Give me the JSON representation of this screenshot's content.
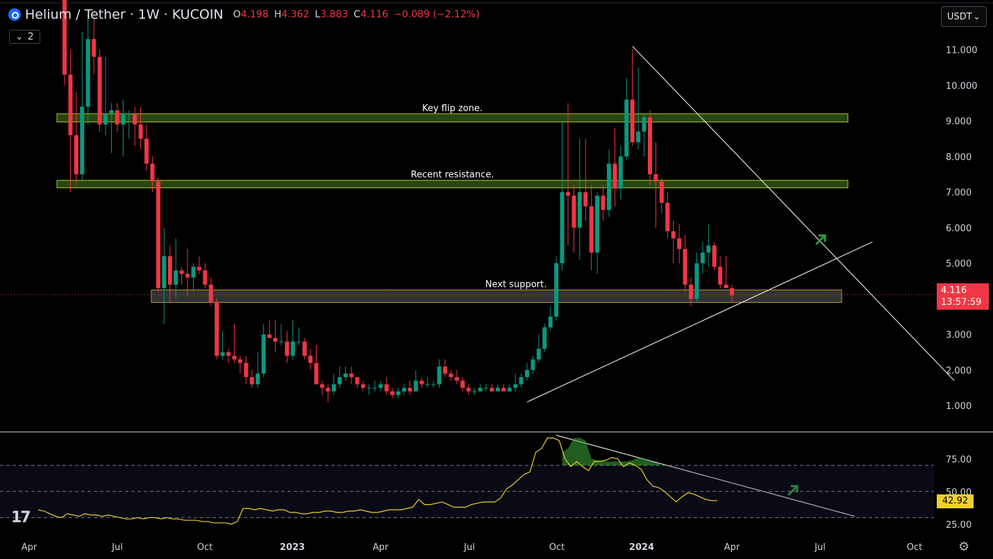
{
  "header": {
    "title": "Helium / Tether · 1W · KUCOIN",
    "open_label": "O",
    "open": "4.198",
    "high_label": "H",
    "high": "4.362",
    "low_label": "L",
    "low": "3.883",
    "close_label": "C",
    "close": "4.116",
    "change": "−0.089 (−2.12%)",
    "indicator_count": "2"
  },
  "currency": "USDT",
  "price_tag": {
    "price": "4.116",
    "countdown": "13:57:59"
  },
  "rsi_tag": "42.92",
  "colors": {
    "up": "#089981",
    "down": "#f23645",
    "rsi": "#f0d02b",
    "zone_green": "#4a7f1c",
    "zone_gray": "#6e6e6e"
  },
  "chart_data": {
    "type": "candlestick",
    "symbol": "Helium / Tether",
    "timeframe": "1W",
    "exchange": "KUCOIN",
    "x_ticks": [
      "Apr",
      "Jul",
      "Oct",
      "2023",
      "Apr",
      "Jul",
      "Oct",
      "2024",
      "Apr",
      "Jul",
      "Oct"
    ],
    "y_ticks": [
      "11.000",
      "10.000",
      "9.000",
      "8.000",
      "7.000",
      "6.000",
      "5.000",
      "4.000",
      "3.000",
      "2.000",
      "1.000"
    ],
    "ylim": [
      0.3,
      12.3
    ],
    "candles": [
      [
        12.5,
        13.5,
        10.0,
        10.3
      ],
      [
        10.3,
        11.0,
        7.0,
        8.6
      ],
      [
        8.6,
        9.8,
        7.2,
        7.5
      ],
      [
        7.5,
        11.5,
        7.3,
        9.4
      ],
      [
        9.4,
        12.0,
        8.9,
        11.3
      ],
      [
        11.3,
        11.9,
        10.3,
        10.8
      ],
      [
        10.8,
        11.0,
        8.7,
        8.9
      ],
      [
        8.9,
        10.8,
        8.6,
        9.2
      ],
      [
        9.2,
        9.5,
        8.1,
        9.3
      ],
      [
        9.3,
        9.5,
        8.7,
        8.9
      ],
      [
        8.9,
        9.6,
        8.0,
        9.2
      ],
      [
        9.2,
        9.3,
        8.5,
        9.2
      ],
      [
        9.2,
        9.4,
        8.3,
        8.9
      ],
      [
        8.9,
        9.4,
        8.2,
        8.5
      ],
      [
        8.5,
        8.9,
        7.6,
        7.8
      ],
      [
        7.8,
        8.0,
        7.0,
        7.3
      ],
      [
        7.3,
        7.4,
        4.2,
        4.3
      ],
      [
        4.3,
        6.0,
        3.3,
        5.2
      ],
      [
        5.2,
        5.5,
        3.9,
        4.4
      ],
      [
        4.4,
        5.7,
        4.0,
        4.8
      ],
      [
        4.8,
        4.9,
        4.4,
        4.7
      ],
      [
        4.7,
        5.4,
        4.1,
        4.6
      ],
      [
        4.6,
        5.0,
        4.2,
        4.9
      ],
      [
        4.9,
        5.2,
        4.7,
        4.8
      ],
      [
        4.8,
        5.0,
        4.3,
        4.4
      ],
      [
        4.4,
        4.6,
        3.8,
        3.9
      ],
      [
        3.9,
        4.0,
        2.3,
        2.4
      ],
      [
        2.4,
        3.1,
        2.3,
        2.5
      ],
      [
        2.5,
        2.6,
        2.2,
        2.4
      ],
      [
        2.4,
        3.3,
        2.2,
        2.3
      ],
      [
        2.3,
        2.4,
        1.9,
        2.2
      ],
      [
        2.2,
        2.4,
        1.6,
        1.8
      ],
      [
        1.8,
        2.0,
        1.5,
        1.6
      ],
      [
        1.6,
        2.5,
        1.5,
        1.9
      ],
      [
        1.9,
        3.3,
        1.8,
        3.0
      ],
      [
        3.0,
        3.4,
        2.9,
        2.9
      ],
      [
        2.9,
        3.4,
        2.5,
        2.8
      ],
      [
        2.8,
        3.3,
        2.7,
        2.8
      ],
      [
        2.8,
        3.1,
        2.2,
        2.4
      ],
      [
        2.4,
        3.4,
        2.3,
        2.8
      ],
      [
        2.8,
        3.2,
        2.7,
        2.8
      ],
      [
        2.8,
        2.9,
        2.3,
        2.4
      ],
      [
        2.4,
        2.6,
        2.0,
        2.2
      ],
      [
        2.2,
        2.7,
        1.6,
        1.6
      ],
      [
        1.6,
        1.7,
        1.3,
        1.5
      ],
      [
        1.5,
        1.6,
        1.1,
        1.4
      ],
      [
        1.4,
        1.9,
        1.3,
        1.6
      ],
      [
        1.6,
        2.1,
        1.5,
        1.8
      ],
      [
        1.8,
        2.1,
        1.7,
        1.9
      ],
      [
        1.9,
        2.1,
        1.6,
        1.8
      ],
      [
        1.8,
        1.8,
        1.5,
        1.6
      ],
      [
        1.6,
        1.7,
        1.4,
        1.5
      ],
      [
        1.5,
        1.6,
        1.3,
        1.5
      ],
      [
        1.5,
        1.7,
        1.4,
        1.5
      ],
      [
        1.5,
        1.7,
        1.4,
        1.6
      ],
      [
        1.6,
        1.8,
        1.3,
        1.4
      ],
      [
        1.4,
        1.5,
        1.2,
        1.3
      ],
      [
        1.3,
        1.5,
        1.2,
        1.4
      ],
      [
        1.4,
        1.6,
        1.3,
        1.5
      ],
      [
        1.5,
        1.7,
        1.3,
        1.4
      ],
      [
        1.4,
        2.0,
        1.4,
        1.7
      ],
      [
        1.7,
        1.8,
        1.5,
        1.6
      ],
      [
        1.6,
        1.8,
        1.5,
        1.6
      ],
      [
        1.6,
        1.7,
        1.5,
        1.6
      ],
      [
        1.6,
        2.3,
        1.5,
        2.1
      ],
      [
        2.1,
        2.3,
        1.8,
        1.9
      ],
      [
        1.9,
        2.0,
        1.7,
        1.8
      ],
      [
        1.8,
        2.0,
        1.6,
        1.7
      ],
      [
        1.7,
        1.8,
        1.4,
        1.5
      ],
      [
        1.5,
        1.6,
        1.3,
        1.4
      ],
      [
        1.4,
        1.5,
        1.3,
        1.4
      ],
      [
        1.4,
        1.6,
        1.4,
        1.5
      ],
      [
        1.5,
        1.6,
        1.4,
        1.5
      ],
      [
        1.5,
        1.6,
        1.4,
        1.4
      ],
      [
        1.4,
        1.6,
        1.4,
        1.5
      ],
      [
        1.5,
        1.6,
        1.4,
        1.4
      ],
      [
        1.4,
        1.6,
        1.4,
        1.5
      ],
      [
        1.5,
        1.9,
        1.4,
        1.6
      ],
      [
        1.6,
        1.9,
        1.5,
        1.8
      ],
      [
        1.8,
        2.2,
        1.7,
        2.0
      ],
      [
        2.0,
        2.4,
        1.9,
        2.3
      ],
      [
        2.3,
        3.0,
        2.2,
        2.6
      ],
      [
        2.6,
        3.3,
        2.5,
        3.2
      ],
      [
        3.2,
        3.8,
        3.1,
        3.5
      ],
      [
        3.5,
        5.2,
        3.4,
        5.0
      ],
      [
        5.0,
        9.0,
        4.8,
        7.0
      ],
      [
        7.0,
        9.5,
        5.5,
        6.9
      ],
      [
        6.9,
        7.2,
        5.3,
        6.0
      ],
      [
        6.0,
        8.5,
        5.1,
        7.0
      ],
      [
        7.0,
        8.5,
        6.2,
        6.6
      ],
      [
        6.6,
        7.2,
        4.8,
        5.3
      ],
      [
        5.3,
        7.0,
        4.7,
        6.9
      ],
      [
        6.9,
        7.2,
        6.2,
        6.5
      ],
      [
        6.5,
        8.2,
        6.3,
        7.8
      ],
      [
        7.8,
        8.8,
        6.6,
        7.1
      ],
      [
        7.1,
        8.3,
        6.8,
        8.0
      ],
      [
        8.0,
        10.2,
        7.9,
        9.6
      ],
      [
        9.6,
        11.0,
        8.3,
        8.4
      ],
      [
        8.4,
        10.5,
        8.2,
        8.7
      ],
      [
        8.7,
        9.2,
        8.0,
        9.1
      ],
      [
        9.1,
        9.3,
        7.2,
        7.5
      ],
      [
        7.5,
        8.4,
        6.0,
        7.3
      ],
      [
        7.3,
        7.4,
        6.4,
        6.7
      ],
      [
        6.7,
        7.0,
        5.7,
        5.9
      ],
      [
        5.9,
        6.2,
        5.0,
        5.7
      ],
      [
        5.7,
        6.1,
        5.0,
        5.4
      ],
      [
        5.4,
        5.8,
        4.2,
        4.4
      ],
      [
        4.4,
        4.6,
        3.8,
        4.0
      ],
      [
        4.0,
        5.3,
        3.9,
        5.0
      ],
      [
        5.0,
        5.6,
        4.7,
        5.3
      ],
      [
        5.3,
        6.1,
        4.9,
        5.5
      ],
      [
        5.5,
        5.6,
        4.8,
        4.9
      ],
      [
        4.9,
        5.2,
        4.3,
        4.4
      ],
      [
        4.4,
        5.2,
        4.3,
        4.3
      ],
      [
        4.3,
        4.4,
        3.9,
        4.1
      ]
    ],
    "zones": [
      {
        "label": "Key flip zone.",
        "low": 8.97,
        "high": 9.2
      },
      {
        "label": "Recent resistance.",
        "low": 7.12,
        "high": 7.33
      },
      {
        "label": "Next support.",
        "low": 3.9,
        "high": 4.25
      }
    ],
    "current_price": 4.116,
    "rsi": {
      "ylim": [
        18,
        94
      ],
      "levels": [
        70,
        50,
        30
      ],
      "y_ticks": [
        "75.00",
        "50.00",
        "25.00"
      ],
      "values": [
        36,
        35,
        33,
        31,
        30,
        33,
        32,
        31,
        33,
        32,
        32,
        31,
        32,
        31,
        30,
        29,
        29,
        30,
        29,
        30,
        30,
        29,
        30,
        29,
        29,
        28,
        28,
        28,
        27,
        27,
        26,
        26,
        26,
        25,
        27,
        37,
        37,
        36,
        37,
        36,
        35,
        36,
        36,
        34,
        34,
        33,
        33,
        34,
        34,
        35,
        35,
        34,
        34,
        35,
        35,
        36,
        35,
        34,
        34,
        35,
        36,
        36,
        36,
        37,
        38,
        44,
        40,
        40,
        41,
        42,
        40,
        38,
        38,
        38,
        40,
        41,
        42,
        42,
        42,
        45,
        52,
        55,
        59,
        63,
        65,
        80,
        83,
        91,
        91,
        89,
        75,
        69,
        73,
        69,
        66,
        73,
        73,
        74,
        76,
        75,
        69,
        72,
        70,
        67,
        59,
        54,
        53,
        50,
        46,
        42,
        46,
        49,
        48,
        46,
        44,
        43,
        43
      ]
    },
    "lines": [
      {
        "name": "upper-trendline",
        "from": [
          97,
          11.1
        ],
        "to": [
          152,
          1.7
        ]
      },
      {
        "name": "lower-trendline",
        "from": [
          79,
          1.1
        ],
        "to": [
          138,
          5.6
        ]
      },
      {
        "name": "rsi-trendline",
        "from": [
          84,
          93
        ],
        "to": [
          135,
          31
        ]
      }
    ]
  }
}
